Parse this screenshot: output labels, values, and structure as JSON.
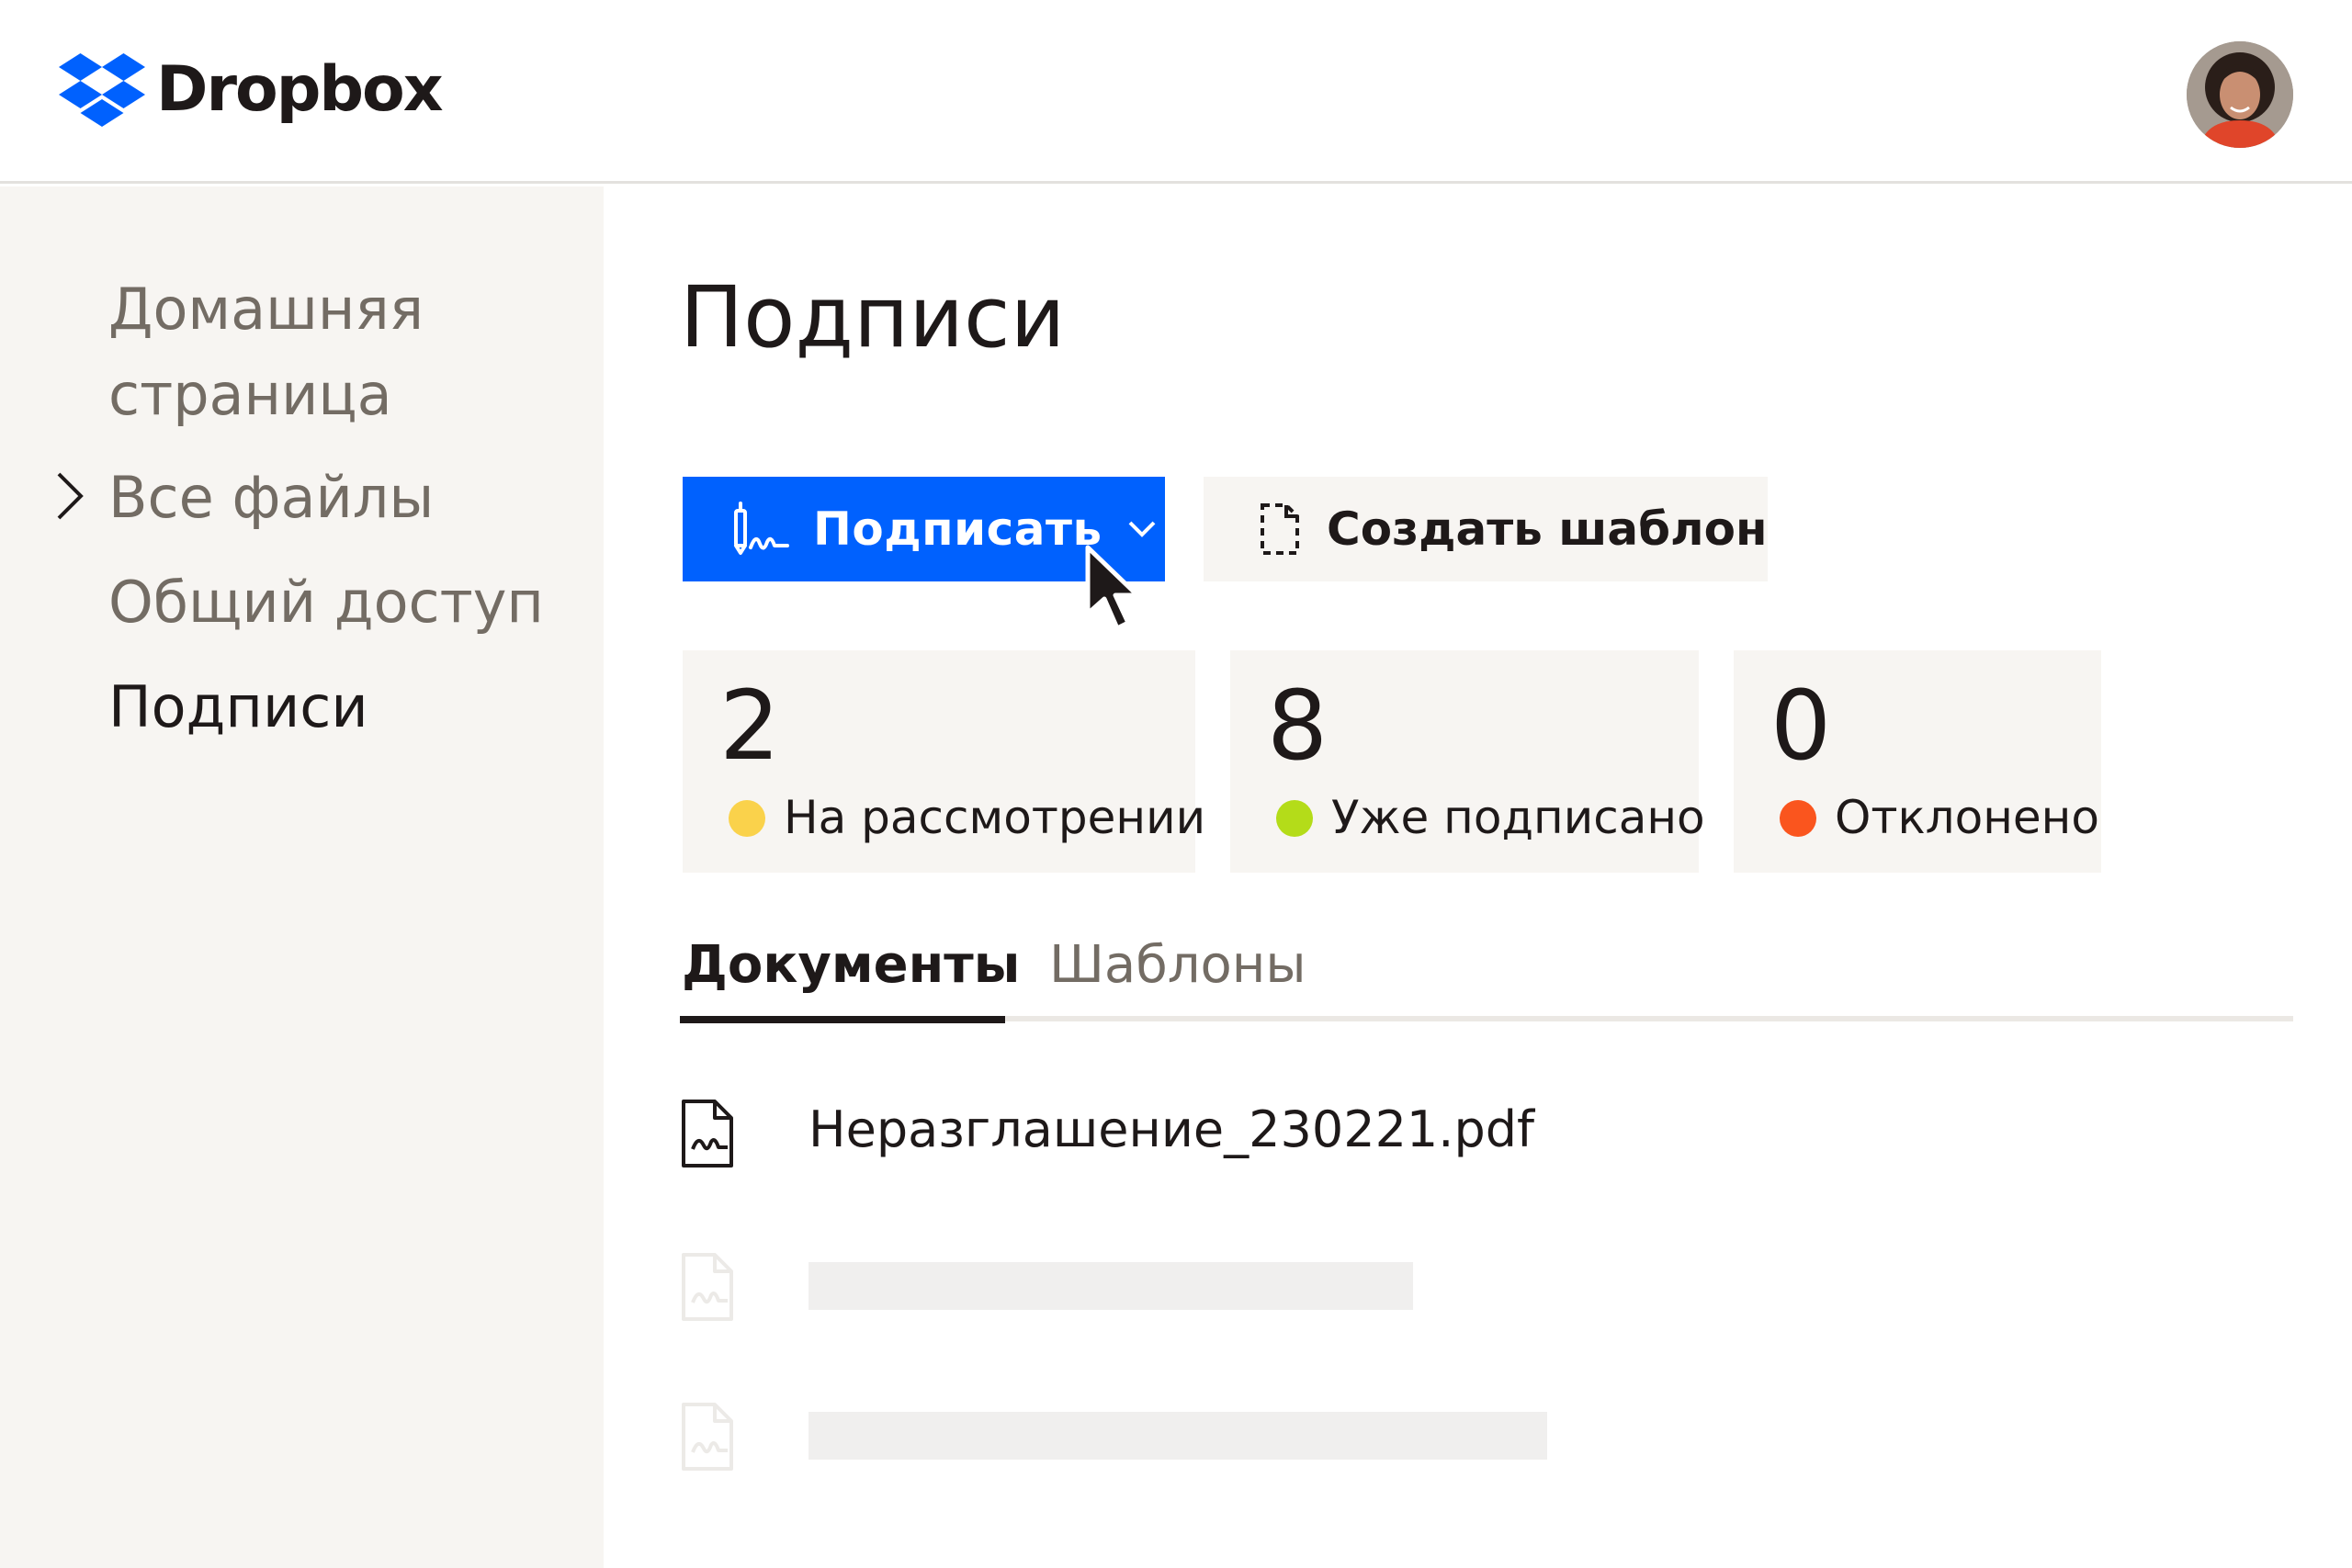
{
  "app": {
    "brand": "Dropbox",
    "brand_color": "#0061fe"
  },
  "header": {
    "logo_icon": "dropbox-logo-icon",
    "avatar_icon": "user-avatar"
  },
  "sidebar": {
    "items": [
      {
        "label": "Домашняя",
        "label2": "страница",
        "active": false
      },
      {
        "label": "Все файлы",
        "icon": "chevron-right-icon",
        "active": false
      },
      {
        "label": "Общий доступ",
        "active": false
      },
      {
        "label": "Подписи",
        "active": true
      }
    ]
  },
  "main": {
    "title": "Подписи",
    "actions": {
      "sign_label": "Подписать",
      "sign_icon": "signature-pen-icon",
      "sign_caret_icon": "chevron-down-icon",
      "template_label": "Создать шаблон",
      "template_icon": "template-document-icon"
    },
    "stats": [
      {
        "value": "2",
        "label": "На рассмотрении",
        "color": "#fad24b"
      },
      {
        "value": "8",
        "label": "Уже подписано",
        "color": "#b4dc19"
      },
      {
        "value": "0",
        "label": "Отклонено",
        "color": "#fa551e"
      }
    ],
    "tabs": [
      {
        "label": "Документы",
        "active": true
      },
      {
        "label": "Шаблоны",
        "active": false
      }
    ],
    "documents": [
      {
        "name": "Неразглашение_230221.pdf",
        "icon": "signed-document-icon"
      }
    ],
    "placeholders": 2
  }
}
